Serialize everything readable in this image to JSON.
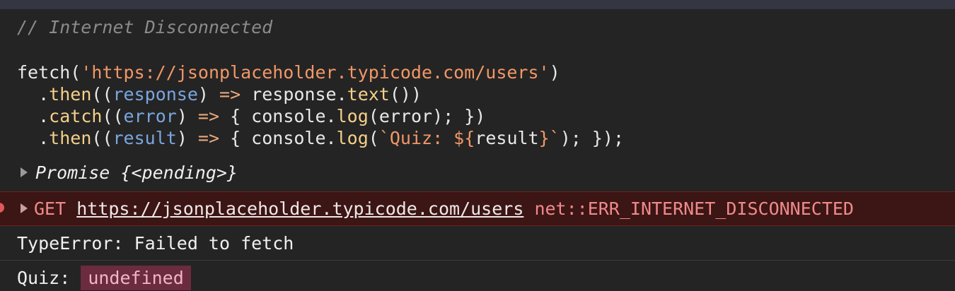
{
  "console": {
    "comment": "// Internet Disconnected",
    "code": {
      "fetch_name": "fetch",
      "paren_open": "(",
      "url_string": "'https://jsonplaceholder.typicode.com/users'",
      "paren_close": ")",
      "then1_dot": ".",
      "then1_name": "then",
      "then1_open": "((",
      "then1_param": "response",
      "then1_after_param": ") ",
      "then1_arrow": "=>",
      "then1_body_a": " response.",
      "then1_method": "text",
      "then1_body_b": "())",
      "catch_dot": ".",
      "catch_name": "catch",
      "catch_open": "((",
      "catch_param": "error",
      "catch_after_param": ") ",
      "catch_arrow": "=>",
      "catch_body_a": " { console.",
      "catch_method": "log",
      "catch_body_b": "(error); })",
      "then2_dot": ".",
      "then2_name": "then",
      "then2_open": "((",
      "then2_param": "result",
      "then2_after_param": ") ",
      "then2_arrow": "=>",
      "then2_body_a": " { console.",
      "then2_method": "log",
      "then2_body_b": "(",
      "then2_template_a": "`Quiz: ${",
      "then2_template_var": "result",
      "then2_template_b": "}`",
      "then2_body_c": "); });"
    },
    "promise_result": "Promise {<pending>}",
    "network_error": {
      "method": "GET",
      "url": "https://jsonplaceholder.typicode.com/users",
      "error": "net::ERR_INTERNET_DISCONNECTED"
    },
    "type_error": "TypeError: Failed to fetch",
    "quiz_log": {
      "label": "Quiz: ",
      "value": "undefined"
    }
  },
  "colors": {
    "background": "#242424",
    "topbar": "#343642",
    "error_bg": "#3c1515",
    "string": "#f29766",
    "keyword_fn": "#f5d089",
    "param": "#7aa6e0",
    "undefined_badge_bg": "#6b2c3f"
  },
  "icons": {
    "expand": "triangle-right-icon",
    "error": "error-dot-icon"
  }
}
